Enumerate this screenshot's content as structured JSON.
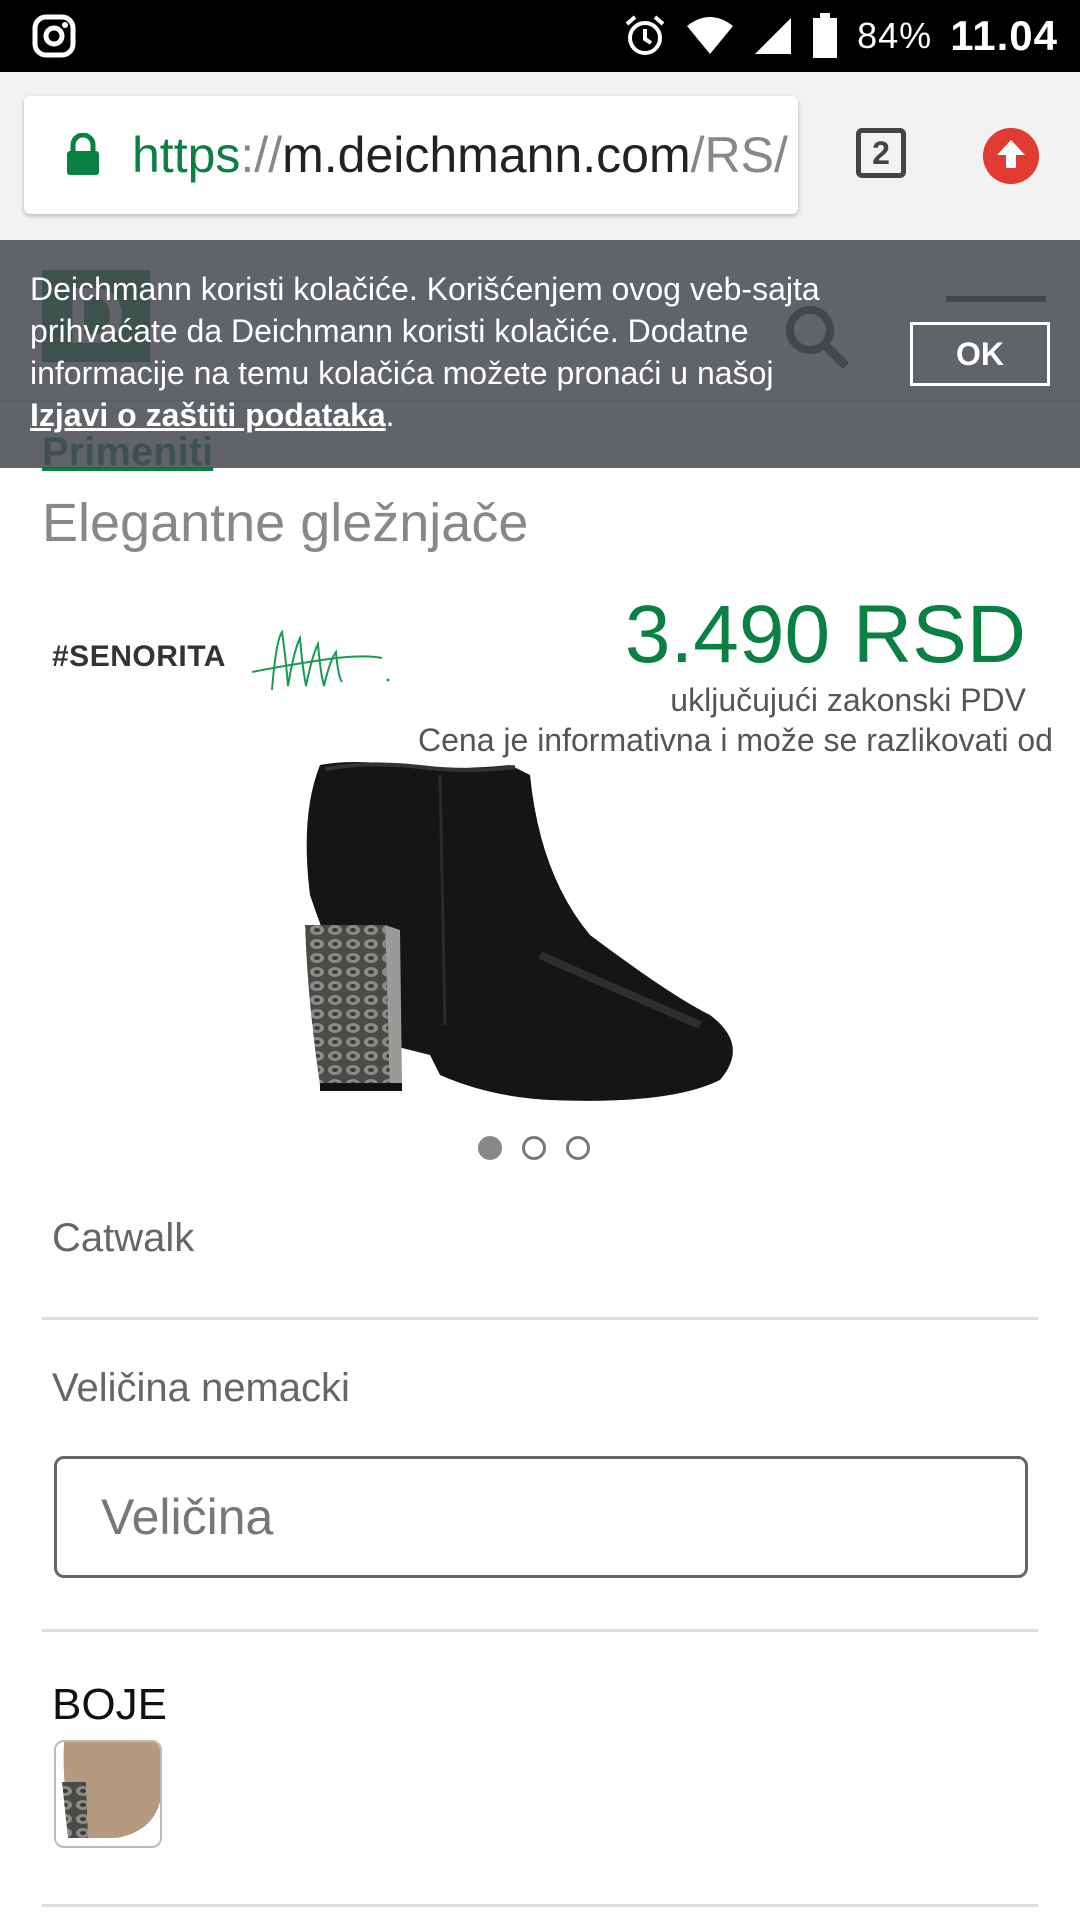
{
  "status_bar": {
    "battery": "84%",
    "time": "11.04",
    "icons": [
      "instagram-icon",
      "alarm-icon",
      "wifi-icon",
      "signal-icon",
      "battery-icon"
    ]
  },
  "browser": {
    "url_scheme": "https",
    "url_sep": "://",
    "url_host": "m.deichmann.com",
    "url_path": "/RS/",
    "tab_count": "2"
  },
  "header": {
    "logo": "D",
    "apply_link": "Primeniti"
  },
  "cookie": {
    "text": "Deichmann koristi kolačiće. Korišćenjem ovog veb-sajta prihvaćate da Deichmann koristi kolačiće. Dodatne informacije na temu kolačića možete pronaći u našoj ",
    "link": "Izjavi o zaštiti podataka",
    "tail": ".",
    "ok": "OK"
  },
  "product": {
    "title": "Elegantne gležnjače",
    "brand": "#SENORITA",
    "price": "3.490 RSD",
    "vat": "uključujući zakonski PDV",
    "info": "Cena je informativna i može se razlikovati od"
  },
  "details": {
    "catwalk": "Catwalk",
    "size_label": "Veličina nemacki",
    "size_placeholder": "Veličina",
    "colors_label": "BOJE"
  },
  "colors": {
    "brand_green": "#0b8043",
    "banner": "#464a4f",
    "update_red": "#e03c31"
  }
}
